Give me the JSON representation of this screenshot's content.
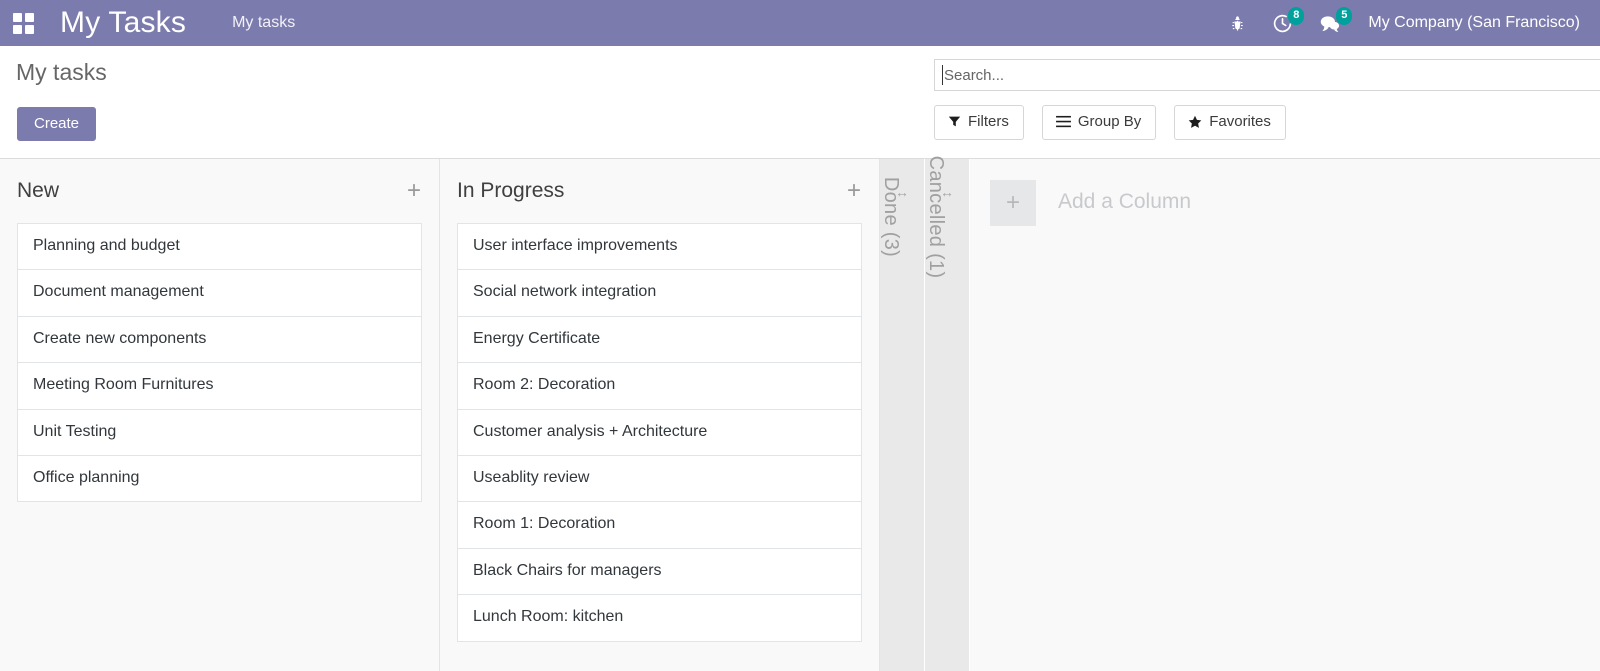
{
  "topbar": {
    "apps_icon": "apps-grid-icon",
    "brand": "My Tasks",
    "breadcrumb": "My tasks",
    "bug_icon": "bug-icon",
    "activity_icon": "clock-icon",
    "activity_count": "8",
    "messages_icon": "chat-bubble-icon",
    "messages_count": "5",
    "company": "My Company (San Francisco)",
    "bg_color": "#7c7bad",
    "badge_color": "#00a09d"
  },
  "control_panel": {
    "page_title": "My tasks",
    "create_label": "Create",
    "search": {
      "value": "",
      "placeholder": "Search..."
    },
    "buttons": [
      {
        "label": "Filters",
        "icon": "funnel-icon"
      },
      {
        "label": "Group By",
        "icon": "hamburger-icon"
      },
      {
        "label": "Favorites",
        "icon": "star-icon"
      }
    ]
  },
  "kanban": {
    "add_icon": "plus-icon",
    "columns": [
      {
        "title": "New",
        "cards": [
          "Planning and budget",
          "Document management",
          "Create new components",
          "Meeting Room Furnitures",
          "Unit Testing",
          "Office planning"
        ]
      },
      {
        "title": "In Progress",
        "cards": [
          "User interface improvements",
          "Social network integration",
          "Energy Certificate",
          "Room 2: Decoration",
          "Customer analysis + Architecture",
          "Useablity review",
          "Room 1: Decoration",
          "Black Chairs for managers",
          "Lunch Room: kitchen"
        ]
      }
    ],
    "collapsed_columns": [
      {
        "label": "Done (3)",
        "handle_icon": "resize-horizontal-icon"
      },
      {
        "label": "Cancelled (1)",
        "handle_icon": "resize-horizontal-icon"
      }
    ],
    "add_column": {
      "plus": "+",
      "label": "Add a Column"
    }
  }
}
